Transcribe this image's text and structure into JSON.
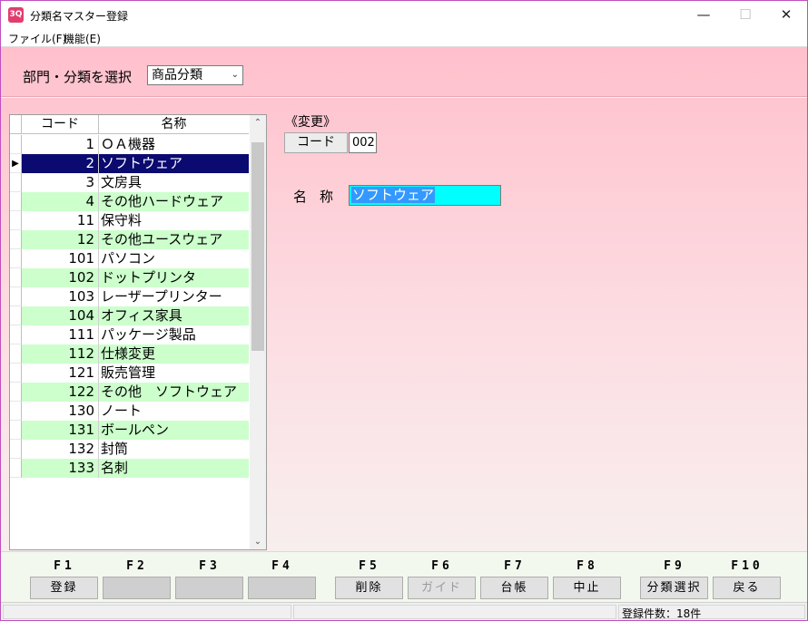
{
  "window": {
    "title": "分類名マスター登録",
    "icon_text": "3Q",
    "controls": {
      "minimize": "—",
      "maximize": "☐",
      "close": "✕"
    }
  },
  "menu": [
    {
      "label": "ファイル(F)"
    },
    {
      "label": "機能(E)"
    }
  ],
  "selector": {
    "label": "部門・分類を選択",
    "value": "商品分類"
  },
  "grid": {
    "headers": {
      "code": "コード",
      "name": "名称"
    },
    "rows": [
      {
        "code": "1",
        "name": "ＯＡ機器"
      },
      {
        "code": "2",
        "name": "ソフトウェア",
        "selected": true
      },
      {
        "code": "3",
        "name": "文房具"
      },
      {
        "code": "4",
        "name": "その他ハードウェア"
      },
      {
        "code": "11",
        "name": "保守料"
      },
      {
        "code": "12",
        "name": "その他ユースウェア"
      },
      {
        "code": "101",
        "name": "パソコン"
      },
      {
        "code": "102",
        "name": "ドットプリンタ"
      },
      {
        "code": "103",
        "name": "レーザープリンター"
      },
      {
        "code": "104",
        "name": "オフィス家具"
      },
      {
        "code": "111",
        "name": "パッケージ製品"
      },
      {
        "code": "112",
        "name": "仕様変更"
      },
      {
        "code": "121",
        "name": "販売管理"
      },
      {
        "code": "122",
        "name": "その他　ソフトウェア"
      },
      {
        "code": "130",
        "name": "ノート"
      },
      {
        "code": "131",
        "name": "ボールペン"
      },
      {
        "code": "132",
        "name": "封筒"
      },
      {
        "code": "133",
        "name": "名刺"
      }
    ],
    "current_marker": "▶"
  },
  "form": {
    "mode_label": "《変更》",
    "code_label": "コード",
    "code_value": "002",
    "name_label": "名称",
    "name_value": "ソフトウェア"
  },
  "fkeys": [
    {
      "key": "F1",
      "label": "登録"
    },
    {
      "key": "F2",
      "label": ""
    },
    {
      "key": "F3",
      "label": ""
    },
    {
      "key": "F4",
      "label": ""
    },
    {
      "key": "F5",
      "label": "削除"
    },
    {
      "key": "F6",
      "label": "ガイド",
      "disabled": true
    },
    {
      "key": "F7",
      "label": "台帳"
    },
    {
      "key": "F8",
      "label": "中止"
    },
    {
      "key": "F9",
      "label": "分類選択"
    },
    {
      "key": "F10",
      "label": "戻る"
    }
  ],
  "status": {
    "count_text": "登録件数：18件"
  },
  "colors": {
    "row_alt": "#ccffcc",
    "row_selected": "#0a0a70",
    "name_input_bg": "#00ffff",
    "content_top": "#ffc0cc"
  }
}
